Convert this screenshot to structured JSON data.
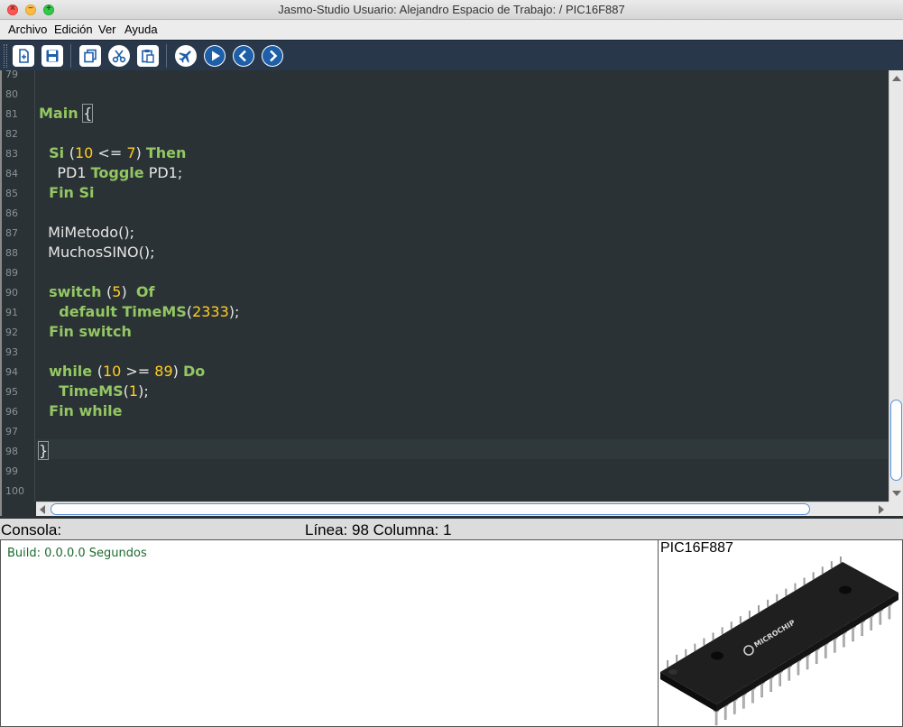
{
  "window": {
    "title": "Jasmo-Studio     Usuario: Alejandro  Espacio de Trabajo: /  PIC16F887",
    "close_glyph": "×",
    "min_glyph": "−",
    "max_glyph": "+"
  },
  "menu": {
    "items": [
      "Archivo",
      "Edición",
      "Ver",
      "Ayuda"
    ]
  },
  "toolbar": {
    "buttons": [
      {
        "name": "new-file",
        "icon": "new-file-icon"
      },
      {
        "name": "save",
        "icon": "save-icon"
      },
      {
        "name": "copy",
        "icon": "copy-icon"
      },
      {
        "name": "cut",
        "icon": "scissors-icon"
      },
      {
        "name": "paste",
        "icon": "paste-icon"
      },
      {
        "name": "compile",
        "icon": "airplane-icon"
      },
      {
        "name": "run",
        "icon": "play-icon"
      },
      {
        "name": "back",
        "icon": "chevron-left-icon"
      },
      {
        "name": "forward",
        "icon": "chevron-right-icon"
      }
    ]
  },
  "editor": {
    "line_numbers": [
      "79",
      "80",
      "81",
      "82",
      "83",
      "84",
      "85",
      "86",
      "87",
      "88",
      "89",
      "90",
      "91",
      "92",
      "93",
      "94",
      "95",
      "96",
      "97",
      "98",
      "99",
      "100"
    ],
    "current_line": "98",
    "lines": [
      {
        "no": "81",
        "tokens": [
          {
            "t": "Main ",
            "c": "kw"
          },
          {
            "t": "{",
            "c": "brace"
          }
        ]
      },
      {
        "no": "83",
        "tokens": [
          {
            "t": "  Si ",
            "c": "kw"
          },
          {
            "t": "(",
            "c": "txt"
          },
          {
            "t": "10",
            "c": "num"
          },
          {
            "t": " <= ",
            "c": "txt"
          },
          {
            "t": "7",
            "c": "num"
          },
          {
            "t": ") ",
            "c": "txt"
          },
          {
            "t": "Then",
            "c": "kw"
          }
        ]
      },
      {
        "no": "84",
        "tokens": [
          {
            "t": "    PD1 ",
            "c": "txt"
          },
          {
            "t": "Toggle",
            "c": "kw"
          },
          {
            "t": " PD1;",
            "c": "txt"
          }
        ]
      },
      {
        "no": "85",
        "tokens": [
          {
            "t": "  Fin Si",
            "c": "kw"
          }
        ]
      },
      {
        "no": "87",
        "tokens": [
          {
            "t": "  MiMetodo();",
            "c": "txt"
          }
        ]
      },
      {
        "no": "88",
        "tokens": [
          {
            "t": "  MuchosSINO();",
            "c": "txt"
          }
        ]
      },
      {
        "no": "90",
        "tokens": [
          {
            "t": "  switch ",
            "c": "kw"
          },
          {
            "t": "(",
            "c": "txt"
          },
          {
            "t": "5",
            "c": "num"
          },
          {
            "t": ")  ",
            "c": "txt"
          },
          {
            "t": "Of",
            "c": "kw"
          }
        ]
      },
      {
        "no": "91",
        "tokens": [
          {
            "t": "    default TimeMS",
            "c": "kw"
          },
          {
            "t": "(",
            "c": "txt"
          },
          {
            "t": "2333",
            "c": "num"
          },
          {
            "t": ");",
            "c": "txt"
          }
        ]
      },
      {
        "no": "92",
        "tokens": [
          {
            "t": "  Fin switch",
            "c": "kw"
          }
        ]
      },
      {
        "no": "94",
        "tokens": [
          {
            "t": "  while ",
            "c": "kw"
          },
          {
            "t": "(",
            "c": "txt"
          },
          {
            "t": "10",
            "c": "num"
          },
          {
            "t": " >= ",
            "c": "txt"
          },
          {
            "t": "89",
            "c": "num"
          },
          {
            "t": ") ",
            "c": "txt"
          },
          {
            "t": "Do",
            "c": "kw"
          }
        ]
      },
      {
        "no": "95",
        "tokens": [
          {
            "t": "    TimeMS",
            "c": "kw"
          },
          {
            "t": "(",
            "c": "txt"
          },
          {
            "t": "1",
            "c": "num"
          },
          {
            "t": ");",
            "c": "txt"
          }
        ]
      },
      {
        "no": "96",
        "tokens": [
          {
            "t": "  Fin while",
            "c": "kw"
          }
        ]
      },
      {
        "no": "98",
        "tokens": [
          {
            "t": "}",
            "c": "brace"
          }
        ]
      }
    ],
    "colors": {
      "background": "#2b3235",
      "keyword": "#93c763",
      "number": "#ffcd22",
      "text": "#e6e6e6",
      "line_number": "#8a9296"
    }
  },
  "status": {
    "console_label": "Consola:",
    "position": "Línea: 98 Columna: 1"
  },
  "console": {
    "output": "Build: 0.0.0.0 Segundos",
    "output_color": "#1b6b2c"
  },
  "chip": {
    "name": "PIC16F887",
    "brand": "MICROCHIP",
    "pins_per_side": 20
  }
}
